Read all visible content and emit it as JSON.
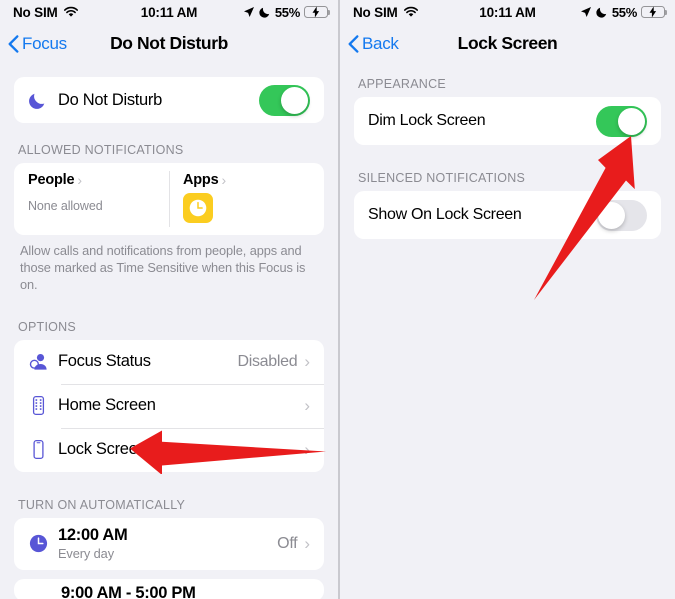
{
  "left": {
    "status_bar": {
      "carrier": "No SIM",
      "wifi_icon": "wifi-icon",
      "time": "10:11 AM",
      "location_icon": "location-arrow-icon",
      "moon_icon": "crescent-moon-icon",
      "battery_percent": "55%",
      "battery_icon": "battery-charging-icon"
    },
    "nav": {
      "back_label": "Focus",
      "title": "Do Not Disturb"
    },
    "dnd": {
      "icon": "crescent-moon-icon",
      "label": "Do Not Disturb",
      "toggle_state": "on"
    },
    "allowed_notifications": {
      "header": "ALLOWED NOTIFICATIONS",
      "people": {
        "title": "People",
        "subtitle": "None allowed"
      },
      "apps": {
        "title": "Apps",
        "app_icon": "clock-app-icon"
      },
      "footnote": "Allow calls and notifications from people, apps and those marked as Time Sensitive when this Focus is on."
    },
    "options": {
      "header": "OPTIONS",
      "items": [
        {
          "icon": "focus-status-people-icon",
          "label": "Focus Status",
          "value": "Disabled",
          "chevron": "›"
        },
        {
          "icon": "home-screen-icon",
          "label": "Home Screen",
          "value": "",
          "chevron": "›"
        },
        {
          "icon": "lock-screen-icon",
          "label": "Lock Screen",
          "value": "",
          "chevron": "›"
        }
      ]
    },
    "turn_on_automatically": {
      "header": "TURN ON AUTOMATICALLY",
      "items": [
        {
          "icon": "clock-icon",
          "title": "12:00 AM",
          "subtitle": "Every day",
          "value": "Off",
          "chevron": "›"
        }
      ],
      "clipped_item_title": "9:00 AM - 5:00 PM"
    },
    "annotation_arrow": "red-arrow-pointing-left-at-lock-screen"
  },
  "right": {
    "status_bar": {
      "carrier": "No SIM",
      "wifi_icon": "wifi-icon",
      "time": "10:11 AM",
      "location_icon": "location-arrow-icon",
      "moon_icon": "crescent-moon-icon",
      "battery_percent": "55%",
      "battery_icon": "battery-charging-icon"
    },
    "nav": {
      "back_label": "Back",
      "title": "Lock Screen"
    },
    "appearance": {
      "header": "APPEARANCE",
      "dim_lock_screen": {
        "label": "Dim Lock Screen",
        "toggle_state": "on"
      }
    },
    "silenced_notifications": {
      "header": "SILENCED NOTIFICATIONS",
      "show_on_lock_screen": {
        "label": "Show On Lock Screen",
        "toggle_state": "off"
      }
    },
    "annotation_arrow": "red-arrow-pointing-up-right-at-dim-lock-screen-toggle"
  },
  "colors": {
    "accent_blue": "#1479ef",
    "toggle_on_green": "#34c759",
    "toggle_off_gray": "#e5e5ea",
    "icon_purple": "#5856d6",
    "app_yellow": "#fbcd20",
    "annotation_red": "#e81c1c",
    "page_background": "#f1f1f6",
    "card_background": "#ffffff",
    "secondary_text": "#8b8b92"
  }
}
